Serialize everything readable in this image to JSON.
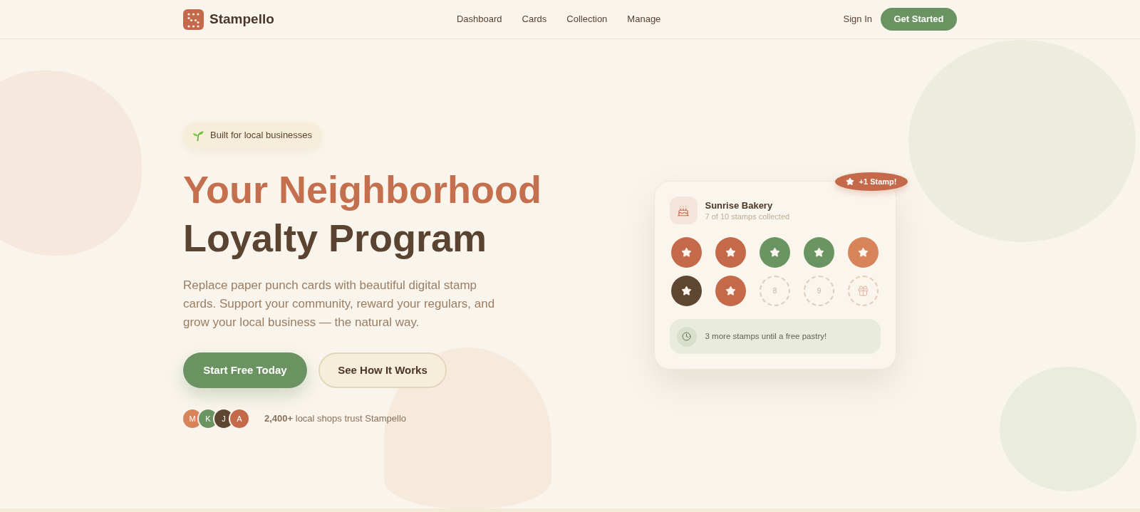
{
  "header": {
    "logo_text": "Stampello",
    "nav": [
      "Dashboard",
      "Cards",
      "Collection",
      "Manage"
    ],
    "sign_in": "Sign In",
    "cta": "Get Started"
  },
  "hero": {
    "badge": "Built for local businesses",
    "headline": [
      {
        "text": "Your Neighborhood",
        "kind": "accent"
      },
      {
        "text": "Loyalty Program",
        "kind": "plain"
      }
    ],
    "description": "Replace paper punch cards with beautiful digital stamp cards. Support your community, reward your regulars, and grow your local business — the natural way.",
    "buttons": [
      {
        "label": "Start Free Today",
        "kind": "primary"
      },
      {
        "label": "See How It Works",
        "kind": "secondary"
      }
    ],
    "social_proof": {
      "avatars": [
        {
          "initial": "M",
          "color": "#d8845a"
        },
        {
          "initial": "K",
          "color": "#6a9461"
        },
        {
          "initial": "J",
          "color": "#5e4630"
        },
        {
          "initial": "A",
          "color": "#c4694a"
        }
      ],
      "text": "**2,400+** local shops trust Stampello"
    }
  },
  "stamp_card": {
    "badge": "+1 Stamp!",
    "title": "Sunrise Bakery",
    "subtitle": "7 of 10 stamps collected",
    "stamps": [
      {
        "kind": "stamped",
        "color": "#c4694a"
      },
      {
        "kind": "stamped",
        "color": "#c4694a"
      },
      {
        "kind": "stamped",
        "color": "#6a9461"
      },
      {
        "kind": "stamped",
        "color": "#6a9461"
      },
      {
        "kind": "stamped",
        "color": "#d8845a"
      },
      {
        "kind": "stamped",
        "color": "#5e4630"
      },
      {
        "kind": "stamped",
        "color": "#c4694a"
      },
      {
        "kind": "empty",
        "label": "8"
      },
      {
        "kind": "empty",
        "label": "9"
      },
      {
        "kind": "reward"
      }
    ],
    "note": "3 more stamps until a free pastry!"
  }
}
